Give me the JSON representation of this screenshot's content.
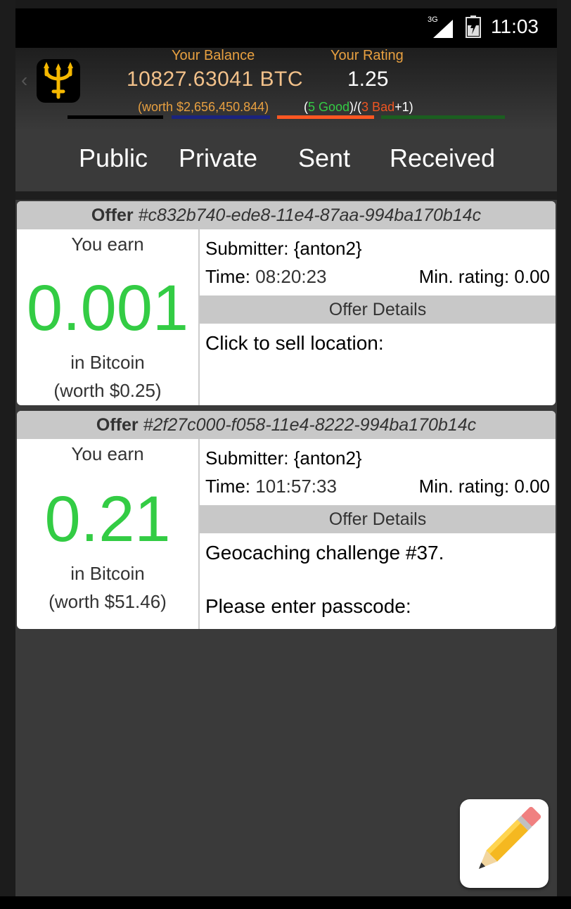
{
  "status_bar": {
    "network": "3G",
    "time": "11:03"
  },
  "header": {
    "balance_label": "Your Balance",
    "balance_value": "10827.63041 BTC",
    "balance_worth": "(worth $2,656,450.844)",
    "rating_label": "Your Rating",
    "rating_value": "1.25",
    "rating_open": "(",
    "good_text": "5 Good",
    "rating_mid": ")/(",
    "bad_text": "3 Bad",
    "rating_close": "+1)"
  },
  "tabs": [
    {
      "label": "Public",
      "color": "#000000"
    },
    {
      "label": "Private",
      "color": "#1a237e"
    },
    {
      "label": "Sent",
      "color": "#ff5722"
    },
    {
      "label": "Received",
      "color": "#1b5e20"
    }
  ],
  "selected_tab": "Sent",
  "offers": [
    {
      "offer_prefix": "Offer",
      "offer_id": "#c832b740-ede8-11e4-87aa-994ba170b14c",
      "earn_label": "You earn",
      "amount": "0.001",
      "currency_label": "in Bitcoin",
      "worth": "(worth $0.25)",
      "submitter": "Submitter: {anton2}",
      "time_label": "Time:",
      "time_value": "08:20:23",
      "min_rating": "Min. rating: 0.00",
      "details_header": "Offer Details",
      "details_lines": [
        "Click to sell location:"
      ]
    },
    {
      "offer_prefix": "Offer",
      "offer_id": "#2f27c000-f058-11e4-8222-994ba170b14c",
      "earn_label": "You earn",
      "amount": "0.21",
      "currency_label": "in Bitcoin",
      "worth": "(worth $51.46)",
      "submitter": "Submitter: {anton2}",
      "time_label": "Time:",
      "time_value": "101:57:33",
      "min_rating": "Min. rating: 0.00",
      "details_header": "Offer Details",
      "details_lines": [
        "Geocaching challenge #37.",
        "Please enter passcode:"
      ]
    }
  ],
  "icons": {
    "app_logo": "trident-icon",
    "fab": "pencil-icon",
    "signal": "signal-icon",
    "battery": "battery-icon"
  },
  "colors": {
    "accent_orange": "#e8a040",
    "earn_green": "#33cc44",
    "bad_red": "#ee5522"
  }
}
